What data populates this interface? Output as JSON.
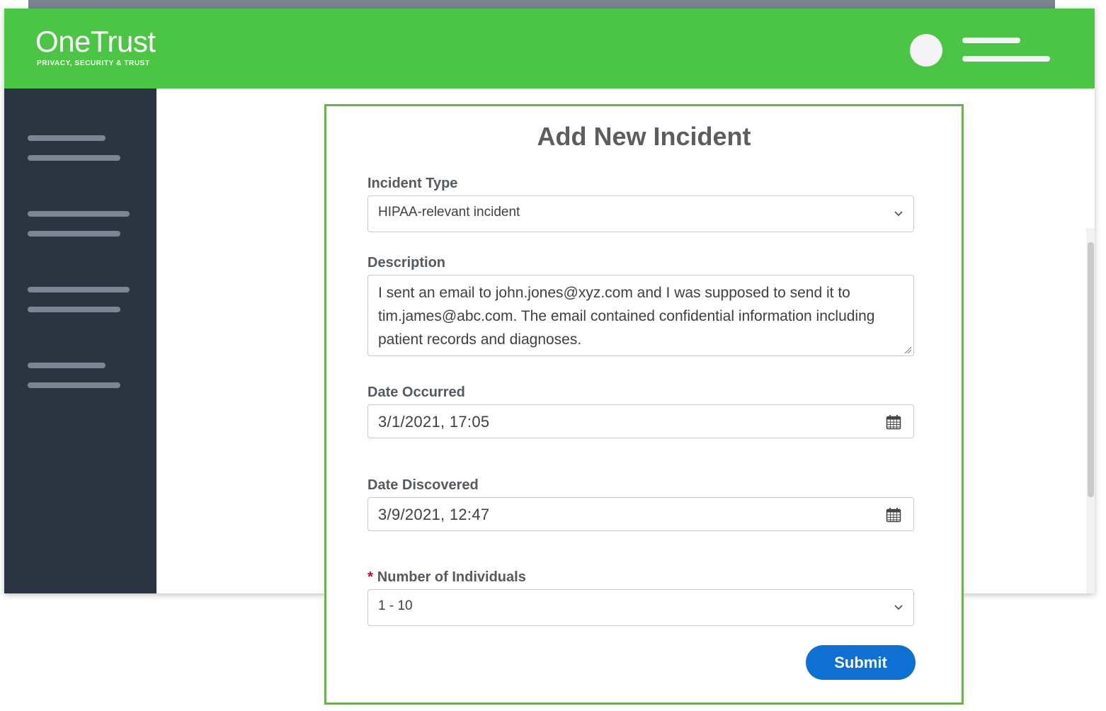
{
  "brand": {
    "name": "OneTrust",
    "tagline": "PRIVACY, SECURITY & TRUST"
  },
  "header": {
    "avatar_icon": "user-avatar-icon",
    "menu_icon": "hamburger-menu-icon"
  },
  "form": {
    "title": "Add New Incident",
    "incident_type": {
      "label": "Incident Type",
      "value": "HIPAA-relevant incident"
    },
    "description": {
      "label": "Description",
      "value": "I sent an email to john.jones@xyz.com and I was supposed to send it to tim.james@abc.com. The email contained confidential information including patient records and diagnoses."
    },
    "date_occurred": {
      "label": "Date Occurred",
      "value": "3/1/2021, 17:05"
    },
    "date_discovered": {
      "label": "Date Discovered",
      "value": "3/9/2021, 12:47"
    },
    "number_of_individuals": {
      "required_marker": "*",
      "label": "Number of Individuals",
      "value": "1 - 10"
    },
    "submit_label": "Submit"
  },
  "colors": {
    "header_green": "#4ac644",
    "sidebar": "#2b3541",
    "modal_border": "#6ab04c",
    "submit_blue": "#0d70d2",
    "required_red": "#d0021b"
  }
}
